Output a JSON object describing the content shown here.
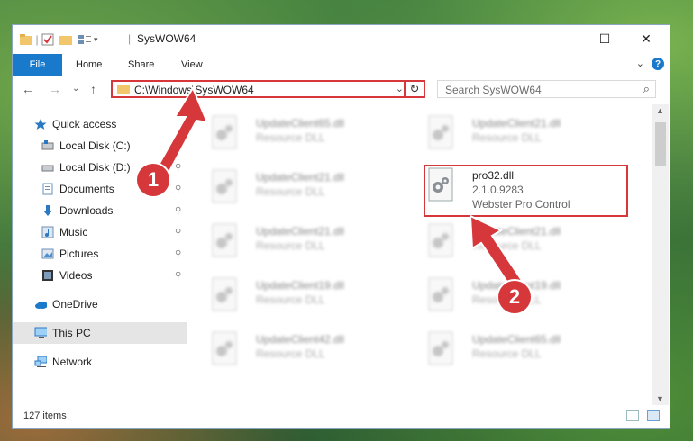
{
  "window": {
    "title": "SysWOW64",
    "controls": {
      "minimize": "—",
      "maximize": "☐",
      "close": "✕"
    }
  },
  "ribbon": {
    "file": "File",
    "tabs": [
      "Home",
      "Share",
      "View"
    ],
    "expand": "⌄",
    "help": "?"
  },
  "navigation": {
    "back": "←",
    "forward": "→",
    "recent": "⌄",
    "up": "↑",
    "address": "C:\\Windows\\SysWOW64",
    "address_dropdown": "⌄",
    "refresh": "↻",
    "search_placeholder": "Search SysWOW64",
    "search_icon": "⌕"
  },
  "sidebar": {
    "items": [
      {
        "label": "Quick access",
        "icon": "star-icon",
        "pinned": false
      },
      {
        "label": "Local Disk (C:)",
        "icon": "drive-icon",
        "pinned": true
      },
      {
        "label": "Local Disk (D:)",
        "icon": "drive-icon",
        "pinned": true
      },
      {
        "label": "Documents",
        "icon": "documents-icon",
        "pinned": true
      },
      {
        "label": "Downloads",
        "icon": "downloads-icon",
        "pinned": true
      },
      {
        "label": "Music",
        "icon": "music-icon",
        "pinned": true
      },
      {
        "label": "Pictures",
        "icon": "pictures-icon",
        "pinned": true
      },
      {
        "label": "Videos",
        "icon": "videos-icon",
        "pinned": true
      },
      {
        "label": "OneDrive",
        "icon": "cloud-icon",
        "pinned": false
      },
      {
        "label": "This PC",
        "icon": "computer-icon",
        "pinned": false,
        "selected": true
      },
      {
        "label": "Network",
        "icon": "network-icon",
        "pinned": false
      }
    ],
    "pin_glyph": "📌"
  },
  "files": [
    {
      "name": "UpdateClient65.dll",
      "type": "Resource DLL",
      "blurred": true
    },
    {
      "name": "UpdateClient21.dll",
      "type": "Resource DLL",
      "blurred": true
    },
    {
      "name": "UpdateClient21.dll",
      "type": "Resource DLL",
      "blurred": true
    },
    {
      "name": "pro32.dll",
      "version": "2.1.0.9283",
      "type": "Webster Pro Control",
      "blurred": false,
      "highlighted": true
    },
    {
      "name": "UpdateClient21.dll",
      "type": "Resource DLL",
      "blurred": true
    },
    {
      "name": "UpdateClient21.dll",
      "type": "Resource DLL",
      "blurred": true
    },
    {
      "name": "UpdateClient19.dll",
      "type": "Resource DLL",
      "blurred": true
    },
    {
      "name": "UpdateClient19.dll",
      "type": "Resource DLL",
      "blurred": true
    },
    {
      "name": "UpdateClient42.dll",
      "type": "Resource DLL",
      "blurred": true
    },
    {
      "name": "UpdateClient65.dll",
      "type": "Resource DLL",
      "blurred": true
    }
  ],
  "status": {
    "item_count": "127 items"
  },
  "callouts": [
    {
      "number": "1"
    },
    {
      "number": "2"
    }
  ],
  "colors": {
    "accent": "#1979ca",
    "highlight": "#d6373b"
  }
}
